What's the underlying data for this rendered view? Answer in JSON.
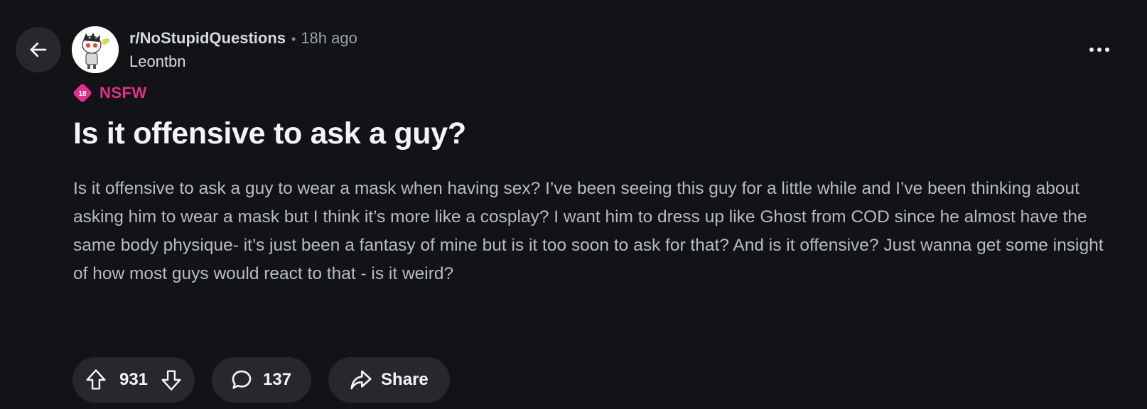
{
  "post": {
    "subreddit": "r/NoStupidQuestions",
    "separator": "•",
    "time_ago": "18h ago",
    "author": "Leontbn",
    "nsfw_badge_number": "18",
    "nsfw_label": "NSFW",
    "title": "Is it offensive to ask a guy?",
    "body": "Is it offensive to ask a guy to wear a mask when having sex? I’ve been seeing this guy for a little while and I’ve been thinking about asking him to wear a mask but I think it’s more like a cosplay? I want him to dress up like Ghost from COD since he almost have the same body physique- it’s just been a fantasy of mine but is it too soon to ask for that? And is it offensive? Just wanna get some insight of how most guys would react to that - is it weird?"
  },
  "actions": {
    "vote_count": "931",
    "comment_count": "137",
    "share_label": "Share"
  },
  "icons": {
    "back": "arrow-left-icon",
    "more": "more-horizontal-icon",
    "nsfw": "nsfw-18-icon",
    "upvote": "arrow-up-icon",
    "downvote": "arrow-down-icon",
    "comment": "speech-bubble-icon",
    "share": "share-arrow-icon"
  },
  "colors": {
    "background": "#121316",
    "pill": "#26282c",
    "nsfw_accent": "#e2308c",
    "text_primary": "#f2f4f5",
    "text_body": "#b8bcbf",
    "text_muted": "#9ea3a7"
  }
}
